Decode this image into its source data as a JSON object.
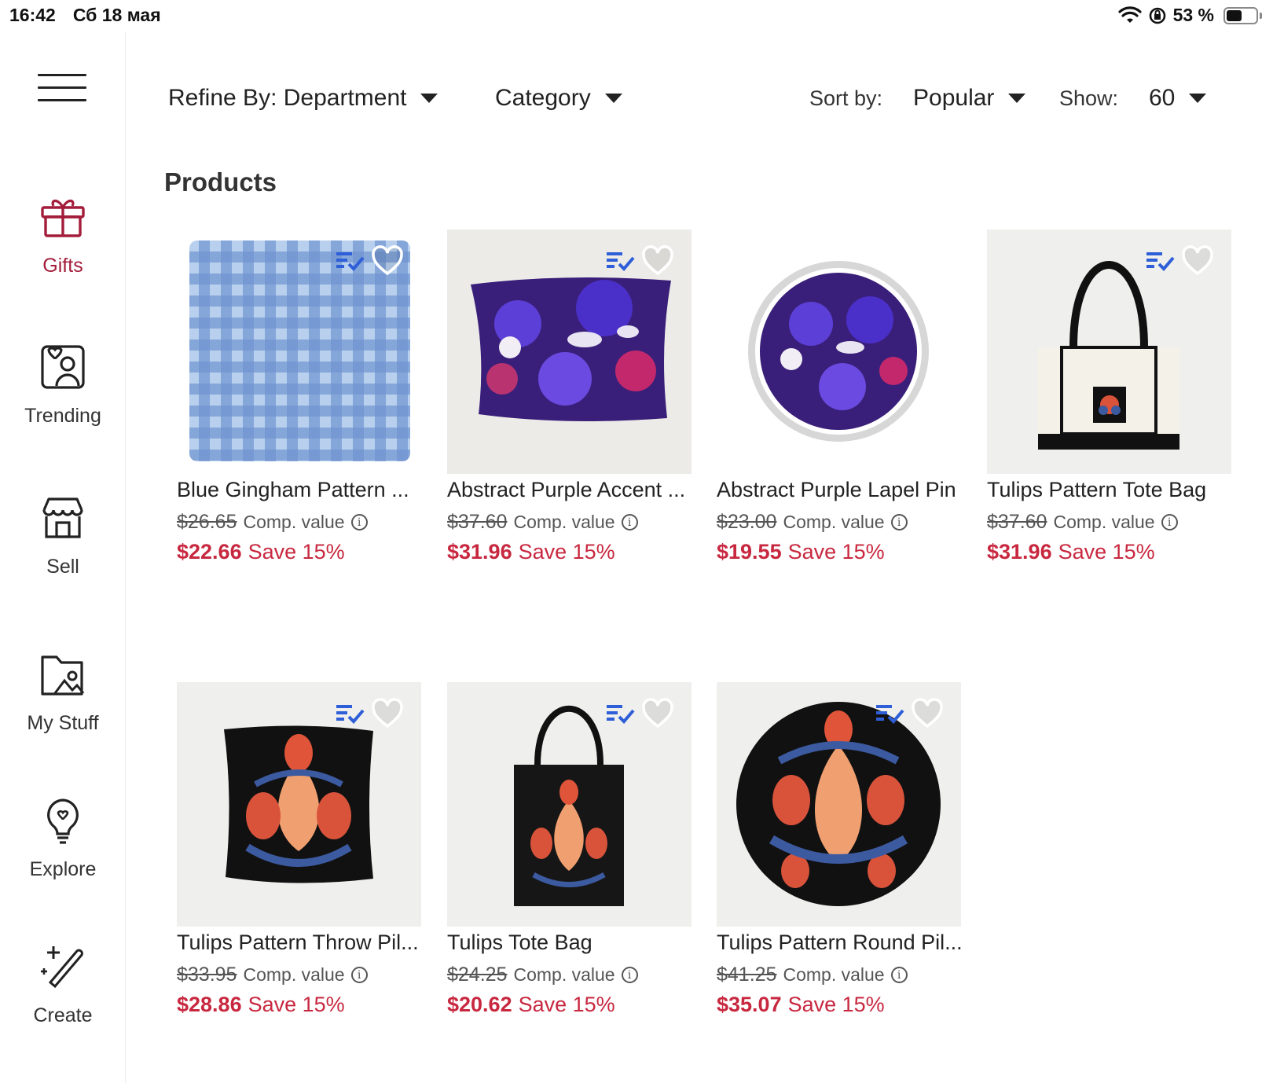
{
  "status_bar": {
    "time": "16:42",
    "date": "Сб 18 мая",
    "battery_text": "53 %",
    "battery_level": 0.53
  },
  "sidebar": {
    "items": [
      {
        "label": "Gifts",
        "icon": "gift-icon",
        "active": true
      },
      {
        "label": "Trending",
        "icon": "trending-icon",
        "active": false
      },
      {
        "label": "Sell",
        "icon": "storefront-icon",
        "active": false
      },
      {
        "label": "My Stuff",
        "icon": "folder-image-icon",
        "active": false
      },
      {
        "label": "Explore",
        "icon": "lightbulb-icon",
        "active": false
      },
      {
        "label": "Create",
        "icon": "magic-wand-icon",
        "active": false
      }
    ]
  },
  "filters": {
    "department_label": "Refine By: Department",
    "category_label": "Category",
    "sort_by_label": "Sort by:",
    "sort_value": "Popular",
    "show_label": "Show:",
    "show_value": "60"
  },
  "section_title": "Products",
  "products": [
    {
      "title": "Blue Gingham Pattern ...",
      "old_price": "$26.65",
      "comp_label": "Comp. value",
      "price": "$22.66",
      "save": "Save 15%",
      "image": "blue-gingham-blanket"
    },
    {
      "title": "Abstract Purple Accent ...",
      "old_price": "$37.60",
      "comp_label": "Comp. value",
      "price": "$31.96",
      "save": "Save 15%",
      "image": "purple-accent-pillow"
    },
    {
      "title": "Abstract Purple Lapel Pin",
      "old_price": "$23.00",
      "comp_label": "Comp. value",
      "price": "$19.55",
      "save": "Save 15%",
      "image": "purple-lapel-pin"
    },
    {
      "title": "Tulips Pattern Tote Bag",
      "old_price": "$37.60",
      "comp_label": "Comp. value",
      "price": "$31.96",
      "save": "Save 15%",
      "image": "tulips-tote-bag-white"
    },
    {
      "title": "Tulips Pattern Throw Pil...",
      "old_price": "$33.95",
      "comp_label": "Comp. value",
      "price": "$28.86",
      "save": "Save 15%",
      "image": "tulips-throw-pillow"
    },
    {
      "title": "Tulips Tote Bag",
      "old_price": "$24.25",
      "comp_label": "Comp. value",
      "price": "$20.62",
      "save": "Save 15%",
      "image": "tulips-tote-bag-black"
    },
    {
      "title": "Tulips Pattern Round Pil...",
      "old_price": "$41.25",
      "comp_label": "Comp. value",
      "price": "$35.07",
      "save": "Save 15%",
      "image": "tulips-round-pillow"
    }
  ],
  "colors": {
    "accent": "#a31d3a",
    "sale": "#c8283f",
    "list_icon": "#2e5fd8"
  }
}
